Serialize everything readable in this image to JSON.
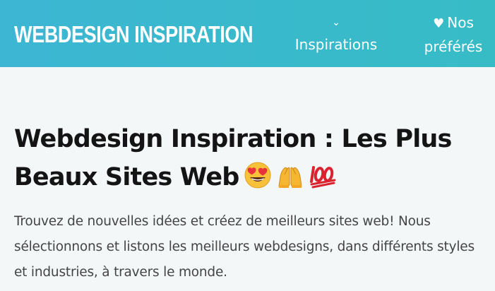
{
  "header": {
    "logo": "WEBDESIGN INSPIRATION",
    "nav": {
      "inspirations_label": "Inspirations",
      "favorites_label": "Nos préférés"
    },
    "icons": {
      "inspirations": "chevron-down-icon",
      "favorites": "heart-icon"
    }
  },
  "hero": {
    "title": "Webdesign Inspiration : Les Plus Beaux Sites Web",
    "emojis": [
      "heart-eyes-emoji",
      "raised-hands-emoji",
      "hundred-points-emoji"
    ],
    "description": "Trouvez de nouvelles idées et créez de meilleurs sites web! Nous sélectionnons et listons les meilleurs webdesigns, dans différents styles et industries, à travers le monde."
  },
  "colors": {
    "header_start": "#3cb6d3",
    "header_end": "#37bcc6",
    "background": "#f4f7f8",
    "title": "#141414",
    "body_text": "#444444"
  }
}
